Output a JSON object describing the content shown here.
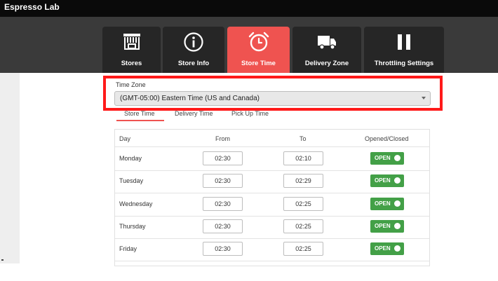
{
  "app": {
    "title": "Espresso Lab"
  },
  "tabs": [
    {
      "label": "Stores",
      "icon": "store-icon"
    },
    {
      "label": "Store Info",
      "icon": "info-icon"
    },
    {
      "label": "Store Time",
      "icon": "alarm-clock-icon",
      "active": true
    },
    {
      "label": "Delivery Zone",
      "icon": "truck-icon"
    },
    {
      "label": "Throttling Settings",
      "icon": "pause-icon"
    }
  ],
  "timezone": {
    "label": "Time Zone",
    "value": "(GMT-05:00) Eastern Time (US and Canada)"
  },
  "subtabs": [
    "Store Time",
    "Delivery Time",
    "Pick Up Time"
  ],
  "table": {
    "headers": {
      "day": "Day",
      "from": "From",
      "to": "To",
      "status": "Opened/Closed"
    },
    "rows": [
      {
        "day": "Monday",
        "from": "02:30",
        "to": "02:10",
        "status": "OPEN"
      },
      {
        "day": "Tuesday",
        "from": "02:30",
        "to": "02:29",
        "status": "OPEN"
      },
      {
        "day": "Wednesday",
        "from": "02:30",
        "to": "02:25",
        "status": "OPEN"
      },
      {
        "day": "Thursday",
        "from": "02:30",
        "to": "02:25",
        "status": "OPEN"
      },
      {
        "day": "Friday",
        "from": "02:30",
        "to": "02:25",
        "status": "OPEN"
      }
    ]
  },
  "colors": {
    "accent": "#ef5350",
    "highlight": "#ff1a1a",
    "toggle_on": "#43a047",
    "header_bg": "#0a0a0a",
    "tab_bg": "#262626"
  }
}
